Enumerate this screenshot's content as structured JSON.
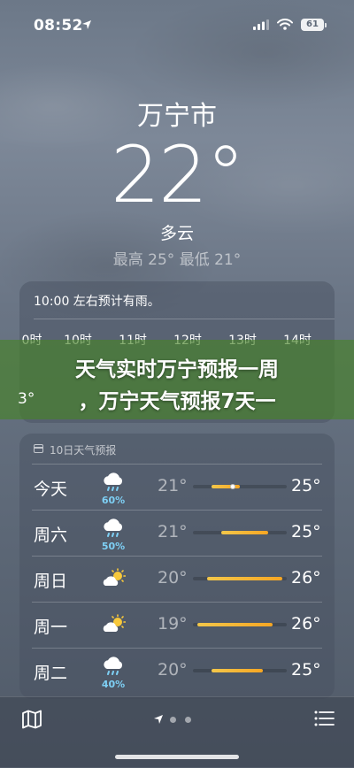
{
  "status_bar": {
    "time": "08:52",
    "battery": "61"
  },
  "hero": {
    "city": "万宁市",
    "temperature": "22°",
    "condition": "多云",
    "high_low": "最高 25°  最低 21°"
  },
  "hourly": {
    "message": "10:00 左右预计有雨。",
    "hours": [
      "0时",
      "10时",
      "11时",
      "12时",
      "13时",
      "14时"
    ],
    "partial_temp": "3°"
  },
  "banner": {
    "line1": "天气实时万宁预报一周",
    "line2": "，万宁天气预报7天一"
  },
  "daily": {
    "title": "10日天气预报",
    "days": [
      {
        "name": "今天",
        "icon": "rain-cloud-icon",
        "pct": "60%",
        "low": "21°",
        "high": "25°",
        "range_start": 0.2,
        "range_end": 0.5,
        "current": 0.42
      },
      {
        "name": "周六",
        "icon": "rain-cloud-icon",
        "pct": "50%",
        "low": "21°",
        "high": "25°",
        "range_start": 0.3,
        "range_end": 0.8
      },
      {
        "name": "周日",
        "icon": "partly-cloudy-icon",
        "pct": "",
        "low": "20°",
        "high": "26°",
        "range_start": 0.15,
        "range_end": 0.95
      },
      {
        "name": "周一",
        "icon": "partly-cloudy-icon",
        "pct": "",
        "low": "19°",
        "high": "26°",
        "range_start": 0.05,
        "range_end": 0.85
      },
      {
        "name": "周二",
        "icon": "rain-cloud-icon",
        "pct": "40%",
        "low": "20°",
        "high": "25°",
        "range_start": 0.2,
        "range_end": 0.75
      }
    ]
  },
  "colors": {
    "bar_start": "#f3c74a",
    "bar_end": "#f6a623",
    "rain_pct": "#7ed0f5"
  }
}
